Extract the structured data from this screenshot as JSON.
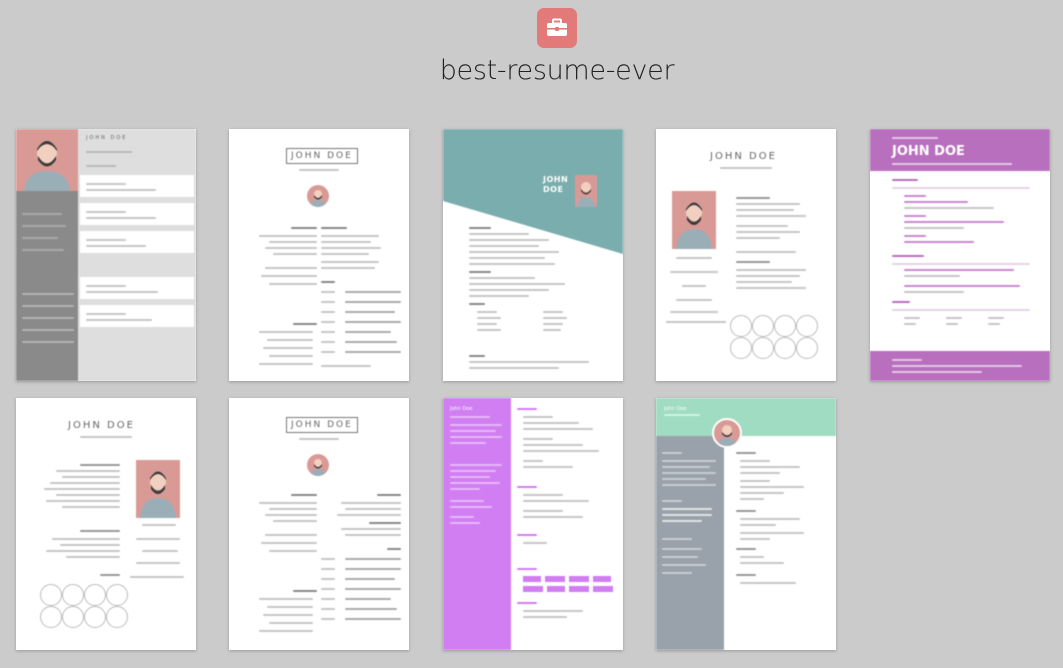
{
  "app": {
    "title": "best-resume-ever",
    "logo_icon": "briefcase-icon"
  },
  "colors": {
    "background": "#cbcbcb",
    "logo": "#e37a7a",
    "avatar": "#d99a96",
    "teal": "#7aadad",
    "purple": "#b86fbd",
    "violet": "#d07ef2",
    "mint": "#9fdcc1",
    "slate": "#99a2aa",
    "gray_sidebar": "#8a8a8a"
  },
  "templates": [
    {
      "id": "left-right",
      "name": "JOHN DOE"
    },
    {
      "id": "oblique",
      "name": "JOHN DOE"
    },
    {
      "id": "side-bar",
      "name": "JOHN DOE"
    },
    {
      "id": "material-dark",
      "name": "JOHN DOE"
    },
    {
      "id": "purple",
      "name": "JOHN DOE"
    },
    {
      "id": "left-right-rtl",
      "name": "JOHN DOE"
    },
    {
      "id": "oblique-rtl",
      "name": "JOHN DOE"
    },
    {
      "id": "violet",
      "name": "John Doe"
    },
    {
      "id": "creative",
      "name": "John Doe"
    }
  ]
}
